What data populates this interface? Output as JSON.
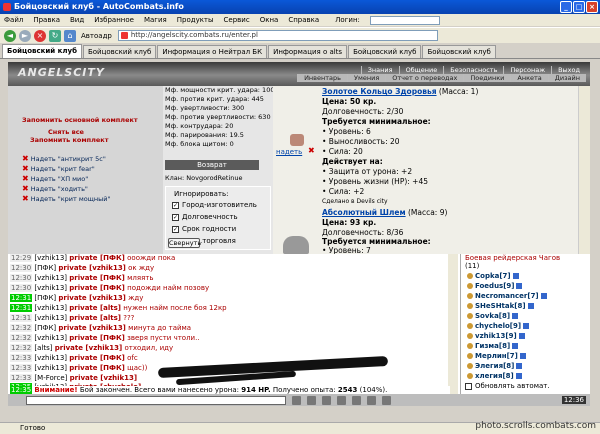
{
  "window": {
    "title": "Бойцовский клуб - AutoCombats.info",
    "buttons": [
      "_",
      "□",
      "×"
    ]
  },
  "menu": {
    "items": [
      "Файл",
      "Правка",
      "Вид",
      "Избранное",
      "Магия",
      "Продукты",
      "Сервис",
      "Окна",
      "Справка"
    ],
    "address_label": "Логин:"
  },
  "toolbar": {
    "autoaddr_label": "Автоадр",
    "url": "http://angelscity.combats.ru/enter.pl"
  },
  "tabs": [
    "Бойцовский клуб",
    "Бойцовский клуб",
    "Информация о Нейтрал БК",
    "Информация о alts",
    "Бойцовский клуб",
    "Бойцовский клуб"
  ],
  "game": {
    "logo": "ANGELSCITY",
    "nav1": [
      "Знания",
      "Общение",
      "Безопасность",
      "Персонаж",
      "Выход"
    ],
    "nav2": [
      "Инвентарь",
      "Умения",
      "Отчет о переводах",
      "Поединки",
      "Анкета",
      "Дизайн"
    ]
  },
  "left": {
    "remember": "Запомнить основной комплект",
    "remove_all": "Снять все",
    "remember2": "Запомнить комплект",
    "wear": [
      "Надеть \"антикрит 5с\"",
      "Надеть \"крит fear\"",
      "Надеть \"ХП мио\"",
      "Надеть \"ходить\"",
      "Надеть \"крит мощный\""
    ]
  },
  "mid": {
    "stats": [
      "Мф. мощности крит. удара: 100",
      "Мф. против крит. удара: 445",
      "Мф. увертливости: 300",
      "Мф. против увертливости: 630",
      "Мф. контрудара: 20",
      "Мф. парирования: 19.5",
      "Мф. блока щитом: 0"
    ],
    "return": "Возврат",
    "clan": "Клан: NovgorodRetinue",
    "ignore_title": "Игнорировать:",
    "ignore_opts": [
      "Город-изготовитель",
      "Долговечность",
      "Срок годности",
      "Масс.торговля"
    ],
    "collapse": "Свернуть"
  },
  "item1": {
    "wear": "надеть",
    "name": "Золотое Кольцо Здоровья",
    "mass": "(Масса: 1)",
    "price": "Цена: 50 кр.",
    "dur": "Долговечность: 2/30",
    "req_h": "Требуется минимальное:",
    "req": [
      "• Уровень: 6",
      "• Выносливость: 20",
      "• Сила: 20"
    ],
    "act_h": "Действует на:",
    "act": [
      "• Защита от урона: +2",
      "• Уровень жизни (HP): +45",
      "• Сила: +2"
    ],
    "made": "Сделано в Devils city"
  },
  "item2": {
    "name": "Абсолютный Шлем",
    "mass": "(Масса: 9)",
    "price": "Цена: 93 кр.",
    "dur": "Долговечность: 8/36",
    "req_h": "Требуется минимальное:",
    "req": [
      "• Уровень: 7"
    ]
  },
  "chat": [
    {
      "t": "12:29",
      "n": "[vzhik13]",
      "p": "private [ПФК]",
      "m": "ооожди пока"
    },
    {
      "t": "12:30",
      "n": "[ПФК]",
      "p": "private [vzhik13]",
      "m": "ок жду"
    },
    {
      "t": "12:30",
      "n": "[vzhik13]",
      "p": "private [ПФК]",
      "m": "мляять"
    },
    {
      "t": "12:30",
      "n": "[vzhik13]",
      "p": "private [ПФК]",
      "m": "подожди найм позову"
    },
    {
      "t": "12:31",
      "n": "[ПФК]",
      "p": "private [vzhik13]",
      "m": "жду",
      "hl": true
    },
    {
      "t": "12:31",
      "n": "[vzhik13]",
      "p": "private [alts]",
      "m": "нужен найм после боя 12кр",
      "hl": true
    },
    {
      "t": "12:31",
      "n": "[vzhik13]",
      "p": "private [alts]",
      "m": "???"
    },
    {
      "t": "12:32",
      "n": "[ПФК]",
      "p": "private [vzhik13]",
      "m": "минута до тайма"
    },
    {
      "t": "12:32",
      "n": "[vzhik13]",
      "p": "private [ПФК]",
      "m": "зверя пусти чтоли.."
    },
    {
      "t": "12:32",
      "n": "[alts]",
      "p": "private [vzhik13]",
      "m": "отходил, иду"
    },
    {
      "t": "12:33",
      "n": "[vzhik13]",
      "p": "private [ПФК]",
      "m": "ofc"
    },
    {
      "t": "12:33",
      "n": "[vzhik13]",
      "p": "private [ПФК]",
      "m": "щас))"
    },
    {
      "t": "12:33",
      "n": "[M-Force]",
      "p": "private [vzhik13]",
      "m": ""
    },
    {
      "t": "12:35",
      "n": "[vzhik13]",
      "p": "private [chychelo]",
      "m": "",
      "hl": true
    }
  ],
  "warning": {
    "t": "12:35",
    "label": "Внимание!",
    "text": "Бой закончен. Всего вами нанесено урона:",
    "dmg": "914 HP.",
    "exp_label": "Получено опыта:",
    "exp": "2543",
    "pct": "(104%)."
  },
  "online": {
    "title": "Боевая рейдерская Чагов",
    "count": "(11)",
    "players": [
      "Copka[7]",
      "Foedus[9]",
      "Necromancer[7]",
      "SHeSHtak[8]",
      "Sovka[8]",
      "chychelo[9]",
      "vzhik13[9]",
      "Гизма[8]",
      "Мерлин[7]",
      "Элегия[8]",
      "хлегия[8]"
    ],
    "refresh": "Обновлять автомат."
  },
  "clock": "12:36",
  "status": {
    "text": "Готово",
    "watermark": "photo.scrolls.combats.com"
  }
}
